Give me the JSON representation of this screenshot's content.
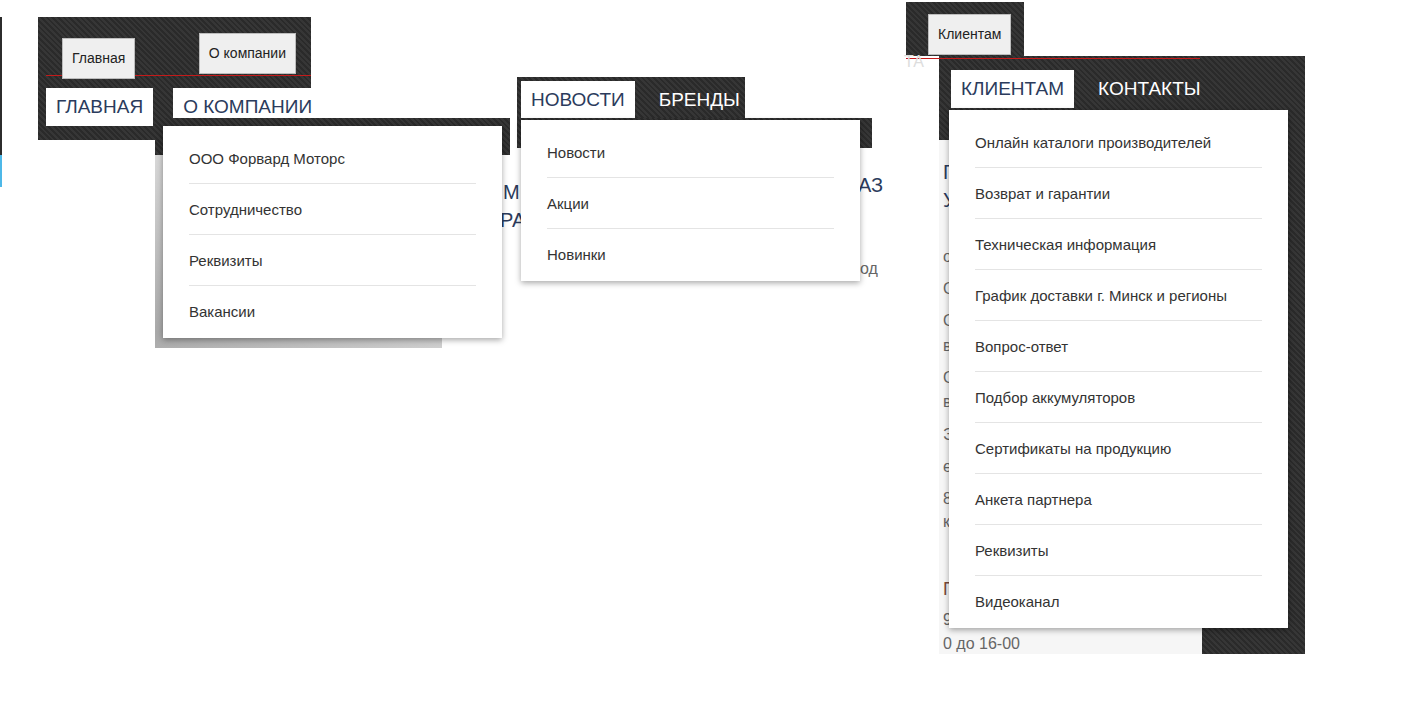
{
  "menus": [
    {
      "buttons": [
        "Главная",
        "О компании"
      ],
      "tabs": [
        {
          "label": "ГЛАВНАЯ",
          "selected": true
        },
        {
          "label": "О КОМПАНИИ",
          "selected": true
        }
      ],
      "items": [
        "ООО Форвард Моторс",
        "Сотрудничество",
        "Реквизиты",
        "Вакансии"
      ]
    },
    {
      "buttons": [],
      "tabs": [
        {
          "label": "НОВОСТИ",
          "selected": true
        },
        {
          "label": "БРЕНДЫ",
          "selected": false
        }
      ],
      "items": [
        "Новости",
        "Акции",
        "Новинки"
      ]
    },
    {
      "buttons": [
        "Клиентам"
      ],
      "tabs": [
        {
          "label": "КЛИЕНТАМ",
          "selected": true
        },
        {
          "label": "КОНТАКТЫ",
          "selected": false
        }
      ],
      "items": [
        "Онлайн каталоги производителей",
        "Возврат и гарантии",
        "Техническая информация",
        "График доставки г. Минск и регионы",
        "Вопрос-ответ",
        "Подбор аккумуляторов",
        "Сертификаты на продукцию",
        "Анкета партнера",
        "Реквизиты",
        "Видеоканал"
      ]
    }
  ],
  "background_fragments": [
    {
      "text": "М",
      "kind": "heading"
    },
    {
      "text": "РА",
      "kind": "heading"
    },
    {
      "text": "АЗ",
      "kind": "heading"
    },
    {
      "text": "од",
      "kind": "body"
    },
    {
      "text": "ТА",
      "kind": "light"
    },
    {
      "text": "Г",
      "kind": "heading"
    },
    {
      "text": "У",
      "kind": "heading"
    },
    {
      "text": "о",
      "kind": "body"
    },
    {
      "text": "О",
      "kind": "body"
    },
    {
      "text": "О",
      "kind": "body"
    },
    {
      "text": "в",
      "kind": "body"
    },
    {
      "text": "О",
      "kind": "body"
    },
    {
      "text": "в",
      "kind": "body"
    },
    {
      "text": "Э",
      "kind": "body"
    },
    {
      "text": "е",
      "kind": "body"
    },
    {
      "text": "8",
      "kind": "body"
    },
    {
      "text": "к",
      "kind": "body"
    },
    {
      "text": "Г",
      "kind": "accent"
    },
    {
      "text": "9",
      "kind": "body"
    },
    {
      "text": "0 до 16-00",
      "kind": "body"
    }
  ]
}
